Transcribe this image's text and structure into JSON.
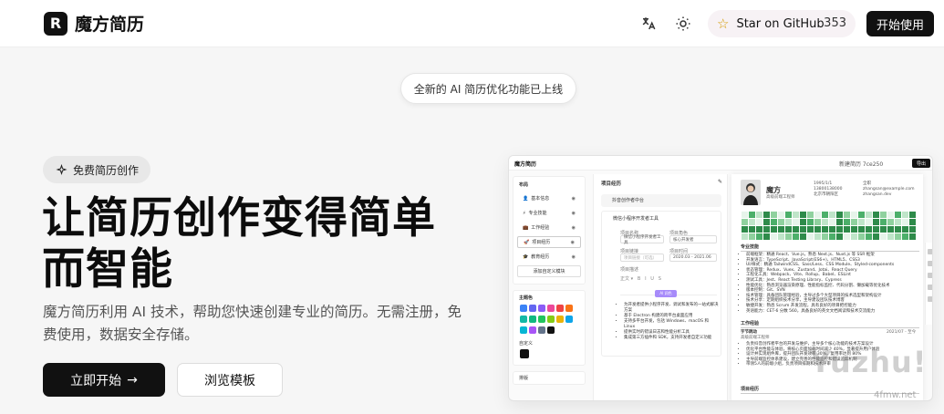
{
  "header": {
    "logo_letter": "R",
    "brand": "魔方简历",
    "translate_icon": "translate-icon",
    "theme_icon": "sun-icon",
    "star_label": "Star on GitHub",
    "star_count": "353",
    "start_label": "开始使用"
  },
  "announcement": "全新的 AI 简历优化功能已上线",
  "hero": {
    "badge": "免费简历创作",
    "title_line1": "让简历创作变得简单",
    "title_line2": "而智能",
    "subtitle": "魔方简历利用 AI 技术，帮助您快速创建专业的简历。无需注册，免费使用，数据安全存储。",
    "primary_cta": "立即开始",
    "secondary_cta": "浏览模板"
  },
  "preview": {
    "app_title": "魔方简历",
    "resume_name_top": "新建简历 7ce250",
    "export_label": "导出",
    "layout_title": "布局",
    "layout_items": [
      "基本信息",
      "专业技能",
      "工作经验",
      "项目经历",
      "教育经历"
    ],
    "add_section": "添加自定义模块",
    "theme_title": "主题色",
    "custom_title": "自定义",
    "typography_title": "排版",
    "theme_colors": [
      "#3b82f6",
      "#6366f1",
      "#8b5cf6",
      "#ec4899",
      "#ef4444",
      "#f97316",
      "#14b8a6",
      "#10b981",
      "#22c55e",
      "#84cc16",
      "#eab308",
      "#0ea5e9",
      "#06b6d4",
      "#a855f7",
      "#64748b",
      "#111111"
    ],
    "editor_title": "项目经历",
    "project_1": "抖音创作者中台",
    "project_2": "微信小程序开发者工具",
    "field_name_label": "项目名称",
    "field_name_value": "微信小程序开发者工具",
    "field_role_label": "项目角色",
    "field_role_value": "核心开发者",
    "field_link_label": "项目链接",
    "field_link_value": "项目链接（可选）",
    "field_time_label": "项目时间",
    "field_time_value": "2020.03 - 2021.06",
    "field_desc_label": "项目描述",
    "ai_label": "AI 润色",
    "desc_lines": [
      "为开发者提供小程序开发、调试和发布的一站式解决方案",
      "基于 Electron 构建的跨平台桌面应用",
      "支持多平台开发，包括 Windows、macOS 和 Linux",
      "提供实时的错误日志和性能分析工具",
      "集成第三方插件和 SDK，支持开发者自定义功能"
    ],
    "resume_name": "魔方",
    "resume_role": "高级前端工程师",
    "resume_contacts": [
      "1995/1/1",
      "全职",
      "13800138000",
      "zhangsan@example.com",
      "北京市朝阳区",
      "zhangsan.dev"
    ],
    "skills_title": "专业技能",
    "skills": [
      "前端框架：精通 React、Vue.js，熟悉 Next.js、Nuxt.js 等 SSR 框架",
      "开发语言：TypeScript、JavaScript(ES6+)、HTML5、CSS3",
      "UI/样式：精通 TailwindCSS、Sass/Less、CSS Module、Styled-components",
      "状态管理：Redux、Vuex、Zustand、Jotai、React Query",
      "工程化工具：Webpack、Vite、Rollup、Babel、ESLint",
      "测试工具：Jest、React Testing Library、Cypress",
      "性能优化：熟悉浏览器渲染原理、性能指标监控、代码分割、懒加载等优化技术",
      "版本控制：Git、SVN",
      "技术管理：具备团队管理经验，主导过多个大型项目的技术选型和架构设计",
      "技术分享：定期组织技术分享，主导建设团队技术博客",
      "敏捷开发：熟悉 Scrum 开发流程，具有良好的项目把控能力",
      "英语能力：CET-6 分数 560，具备良好的英文文档阅读和技术交流能力"
    ],
    "work_title": "工作经验",
    "work_company": "字节跳动",
    "work_role": "高级前端工程师",
    "work_time": "2021/07 - 至今",
    "work_items": [
      "负责抖音创作者平台的开发与维护，主导多个核心功能的技术方案设计",
      "优化平台性能与体验，将核心页面加载时间减少 40%，显著提升用户体验",
      "设计并实现组件库，提升团队开发效率 30%，复用率达到 80%",
      "主导前端监控体系建设，建立完善的性能监控和错误追踪机制",
      "带领5人的前端小组，负责项目排期和技术评审"
    ],
    "projects_title": "项目经历"
  },
  "watermark": "4fmw.net"
}
